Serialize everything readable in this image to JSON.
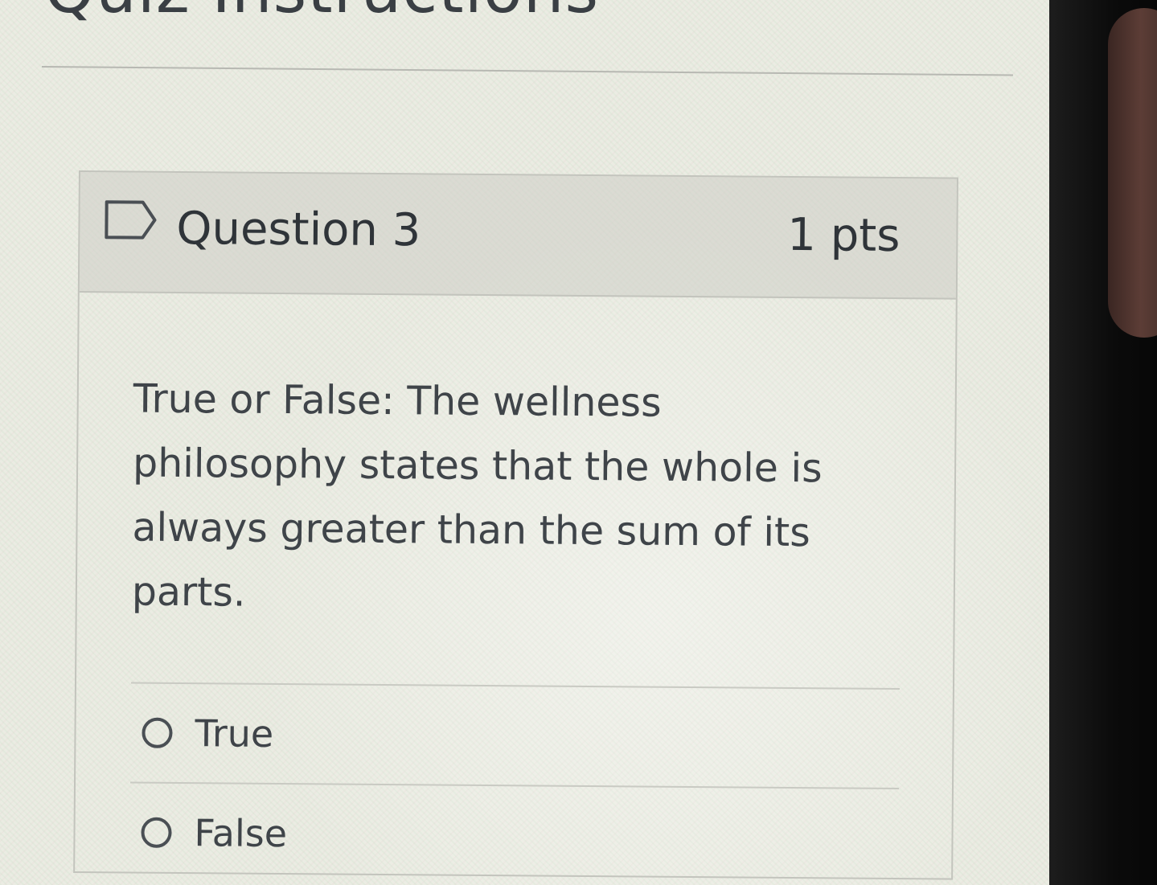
{
  "page": {
    "heading": "Quiz Instructions"
  },
  "question": {
    "title": "Question 3",
    "points": "1 pts",
    "text": "True or False: The wellness philosophy states that the whole is always greater than the sum of its parts.",
    "flag_icon": "flag-outline-icon",
    "answers": [
      {
        "label": "True",
        "selected": false
      },
      {
        "label": "False",
        "selected": false
      }
    ]
  },
  "colors": {
    "screen_background": "#ebece3",
    "text": "#3f4449",
    "border": "#c3c4bd",
    "header_background": "#cdcec6",
    "device_bezel": "#0b0b0b"
  }
}
